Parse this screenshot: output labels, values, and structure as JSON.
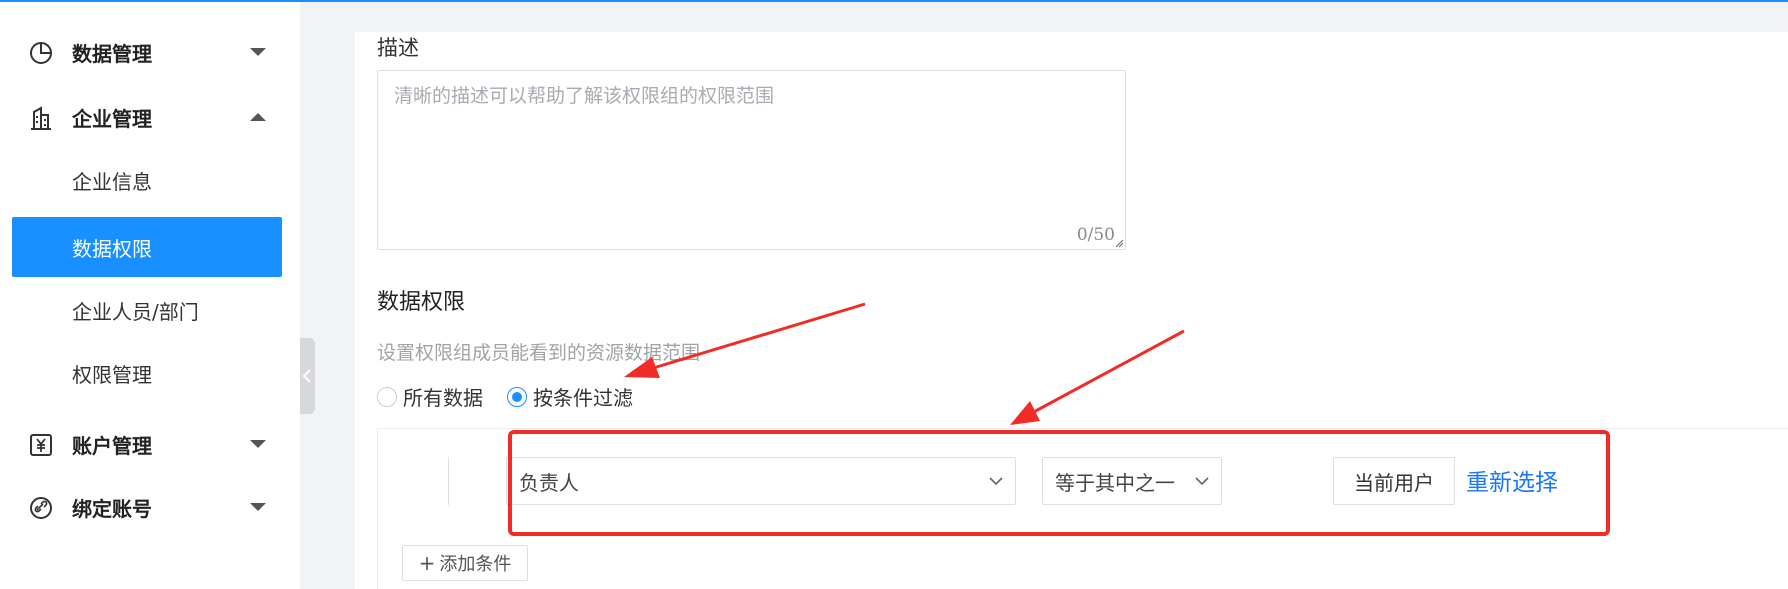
{
  "sidebar": {
    "items": [
      {
        "label": "数据管理",
        "icon": "pie-chart-icon",
        "expanded": false
      },
      {
        "label": "企业管理",
        "icon": "building-icon",
        "expanded": true
      },
      {
        "label": "账户管理",
        "icon": "yen-icon",
        "expanded": false
      },
      {
        "label": "绑定账号",
        "icon": "link-icon",
        "expanded": false
      }
    ],
    "sub_items": [
      {
        "label": "企业信息",
        "active": false
      },
      {
        "label": "数据权限",
        "active": true
      },
      {
        "label": "企业人员/部门",
        "active": false
      },
      {
        "label": "权限管理",
        "active": false
      }
    ]
  },
  "form": {
    "description_label": "描述",
    "description_placeholder": "清晰的描述可以帮助了解该权限组的权限范围",
    "description_value": "",
    "char_counter": "0/50",
    "section_title": "数据权限",
    "section_hint": "设置权限组成员能看到的资源数据范围",
    "scope_options": [
      {
        "label": "所有数据",
        "selected": false
      },
      {
        "label": "按条件过滤",
        "selected": true
      }
    ],
    "condition": {
      "field": "负责人",
      "operator": "等于其中之一",
      "value_button": "当前用户",
      "reselect_link": "重新选择"
    },
    "add_condition_label": "添加条件"
  },
  "colors": {
    "accent": "#1890ff",
    "link": "#1677ff",
    "annotation_red": "#f22b26"
  }
}
